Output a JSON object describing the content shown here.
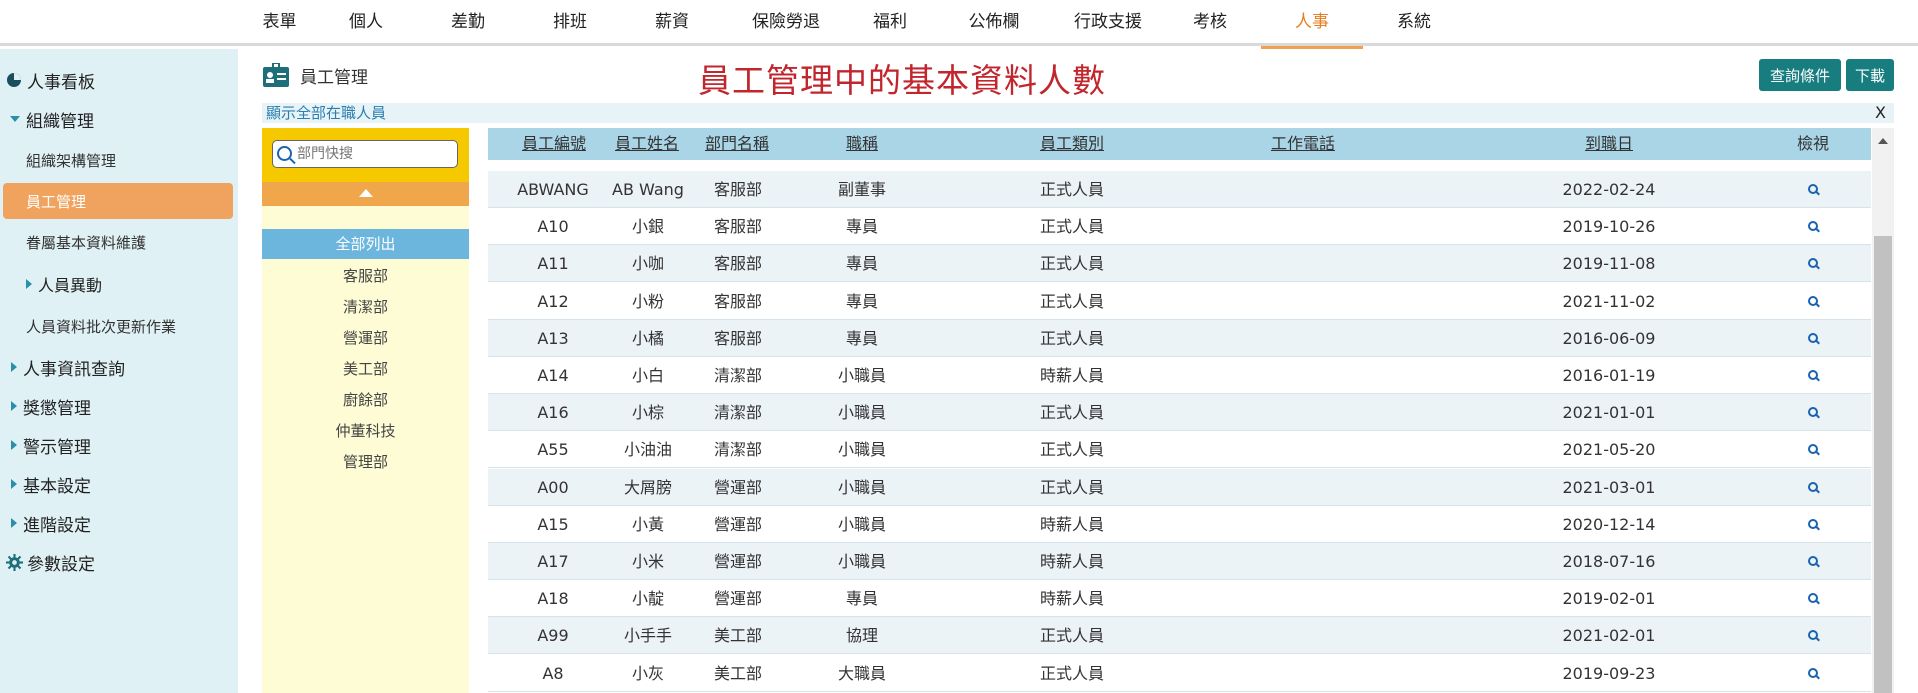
{
  "topnav": [
    "表單",
    "個人",
    "差勤",
    "排班",
    "薪資",
    "保險勞退",
    "福利",
    "公佈欄",
    "行政支援",
    "考核",
    "人事",
    "系統"
  ],
  "topnav_active": "人事",
  "sidebar": {
    "dashboard": "人事看板",
    "org": "組織管理",
    "org_structure": "組織架構管理",
    "employee_mgmt": "員工管理",
    "dependents": "眷屬基本資料維護",
    "changes": "人員異動",
    "batch_update": "人員資料批次更新作業",
    "hr_query": "人事資訊查詢",
    "rewards": "獎懲管理",
    "warnings": "警示管理",
    "basic_settings": "基本設定",
    "advanced_settings": "進階設定",
    "params": "參數設定"
  },
  "header": {
    "label": "員工管理",
    "title": "員工管理中的基本資料人數",
    "query_button": "查詢條件",
    "download_button": "下載"
  },
  "filter": {
    "text": "顯示全部在職人員",
    "close": "X"
  },
  "dept_panel": {
    "search_placeholder": "部門快搜",
    "all_label": "全部列出",
    "departments": [
      "客服部",
      "清潔部",
      "營運部",
      "美工部",
      "廚餘部",
      "仲董科技",
      "管理部"
    ]
  },
  "table": {
    "headers": {
      "emp_no": "員工編號",
      "name": "員工姓名",
      "dept": "部門名稱",
      "title": "職稱",
      "type": "員工類別",
      "phone": "工作電話",
      "start": "到職日",
      "view": "檢視"
    },
    "rows": [
      [
        "ABWANG",
        "AB Wang",
        "客服部",
        "副董事",
        "正式人員",
        "",
        "2022-02-24"
      ],
      [
        "A10",
        "小銀",
        "客服部",
        "專員",
        "正式人員",
        "",
        "2019-10-26"
      ],
      [
        "A11",
        "小咖",
        "客服部",
        "專員",
        "正式人員",
        "",
        "2019-11-08"
      ],
      [
        "A12",
        "小粉",
        "客服部",
        "專員",
        "正式人員",
        "",
        "2021-11-02"
      ],
      [
        "A13",
        "小橘",
        "客服部",
        "專員",
        "正式人員",
        "",
        "2016-06-09"
      ],
      [
        "A14",
        "小白",
        "清潔部",
        "小職員",
        "時薪人員",
        "",
        "2016-01-19"
      ],
      [
        "A16",
        "小棕",
        "清潔部",
        "小職員",
        "正式人員",
        "",
        "2021-01-01"
      ],
      [
        "A55",
        "小油油",
        "清潔部",
        "小職員",
        "正式人員",
        "",
        "2021-05-20"
      ],
      [
        "A00",
        "大屑膀",
        "營運部",
        "小職員",
        "正式人員",
        "",
        "2021-03-01"
      ],
      [
        "A15",
        "小黃",
        "營運部",
        "小職員",
        "時薪人員",
        "",
        "2020-12-14"
      ],
      [
        "A17",
        "小米",
        "營運部",
        "小職員",
        "時薪人員",
        "",
        "2018-07-16"
      ],
      [
        "A18",
        "小靛",
        "營運部",
        "專員",
        "時薪人員",
        "",
        "2019-02-01"
      ],
      [
        "A99",
        "小手手",
        "美工部",
        "協理",
        "正式人員",
        "",
        "2021-02-01"
      ],
      [
        "A8",
        "小灰",
        "美工部",
        "大職員",
        "正式人員",
        "",
        "2019-09-23"
      ]
    ]
  },
  "colors": {
    "accent": "#e67e22",
    "sidebar_bg": "#e0f1f5",
    "active_item": "#f0a35f",
    "title_red": "#c0262c",
    "button": "#177d7f",
    "table_header": "#a9d5e7",
    "dept_yellow": "#f6c800",
    "dept_all": "#6cb5dc"
  }
}
